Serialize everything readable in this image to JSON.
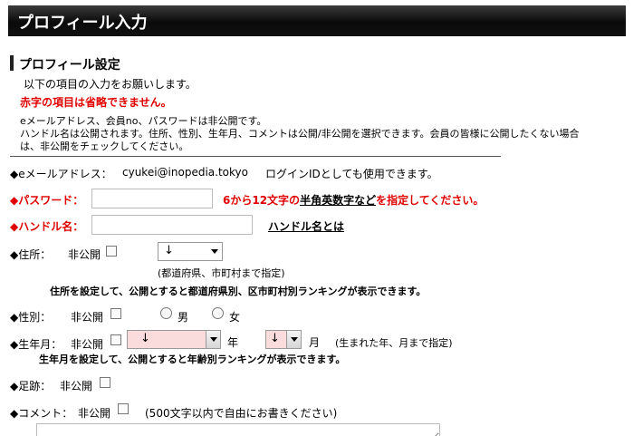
{
  "header": {
    "title": "プロフィール入力"
  },
  "section": {
    "title": "プロフィール設定",
    "intro": "以下の項目の入力をお願いします。",
    "required_notice": "赤字の項目は省略できません。",
    "privacy_line1": "eメールアドレス、会員no、パスワードは非公開です。",
    "privacy_line2": "ハンドル名は公開されます。住所、性別、生年月、コメントは公開/非公開を選択できます。会員の皆様に公開したくない場合",
    "privacy_line3": "は、非公開をチェックしてください。"
  },
  "email": {
    "label": "◆eメールアドレス：",
    "value": "cyukei@inopedia.tokyo",
    "note": "ログインIDとしても使用できます。"
  },
  "password": {
    "label": "◆パスワード：",
    "note_part1": "6から12文字の",
    "note_link": "半角英数字など",
    "note_part2": "を指定してください。"
  },
  "handle": {
    "label": "◆ハンドル名：",
    "link": "ハンドル名とは"
  },
  "address": {
    "label": "◆住所：",
    "private_label": "非公開",
    "select_value": "↓",
    "hint": "(都道府県、市町村まで指定)",
    "note": "住所を設定して、公開とすると都道府県別、区市町村別ランキングが表示できます。"
  },
  "gender": {
    "label": "◆性別：",
    "private_label": "非公開",
    "male": "男",
    "female": "女"
  },
  "birth": {
    "label": "◆生年月：",
    "private_label": "非公開",
    "year_value": "↓",
    "year_unit": "年",
    "month_value": "↓",
    "month_unit": "月",
    "hint": "(生まれた年、月まで指定)",
    "note": "生年月を設定して、公開とすると年齢別ランキングが表示できます。"
  },
  "footprint": {
    "label": "◆足跡：",
    "private_label": "非公開"
  },
  "comment": {
    "label": "◆コメント：",
    "private_label": "非公開",
    "hint": "(500文字以内で自由にお書きください)"
  },
  "colors": {
    "header_bg": "#111111",
    "required": "#e00000",
    "select_highlight": "#fadcdc"
  }
}
